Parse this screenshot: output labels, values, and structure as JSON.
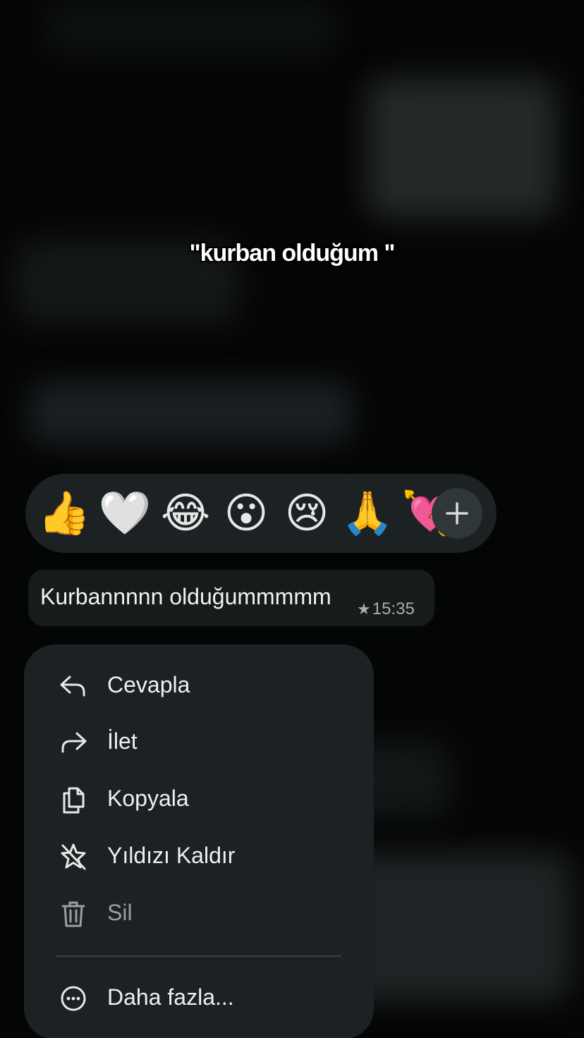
{
  "caption": "\"kurban olduğum \"",
  "reactions": [
    {
      "icon": "thumbs-up-icon",
      "glyph": "👍"
    },
    {
      "icon": "heart-icon",
      "glyph": "🤍"
    },
    {
      "icon": "laughing-tears-icon",
      "glyph": "😂"
    },
    {
      "icon": "surprised-face-icon",
      "glyph": "😮"
    },
    {
      "icon": "crying-face-icon",
      "glyph": "😢"
    },
    {
      "icon": "praying-hands-icon",
      "glyph": "🙏"
    },
    {
      "icon": "heart-with-arrow-icon",
      "glyph": "💘"
    }
  ],
  "add_reaction_icon": "plus-icon",
  "message": {
    "text": "Kurbannnnn olduğummmmm",
    "starred": true,
    "time": "15:35"
  },
  "menu": {
    "items": [
      {
        "label": "Cevapla",
        "icon": "reply-icon"
      },
      {
        "label": "İlet",
        "icon": "forward-icon"
      },
      {
        "label": "Kopyala",
        "icon": "copy-icon"
      },
      {
        "label": "Yıldızı Kaldır",
        "icon": "unstar-icon"
      },
      {
        "label": "Sil",
        "icon": "trash-icon"
      }
    ],
    "more_label": "Daha fazla..."
  },
  "colors": {
    "background": "#040505",
    "panel": "#1c2123",
    "bubble": "#171b1c",
    "text": "#f0f0f0",
    "muted": "#9b9fa0"
  }
}
